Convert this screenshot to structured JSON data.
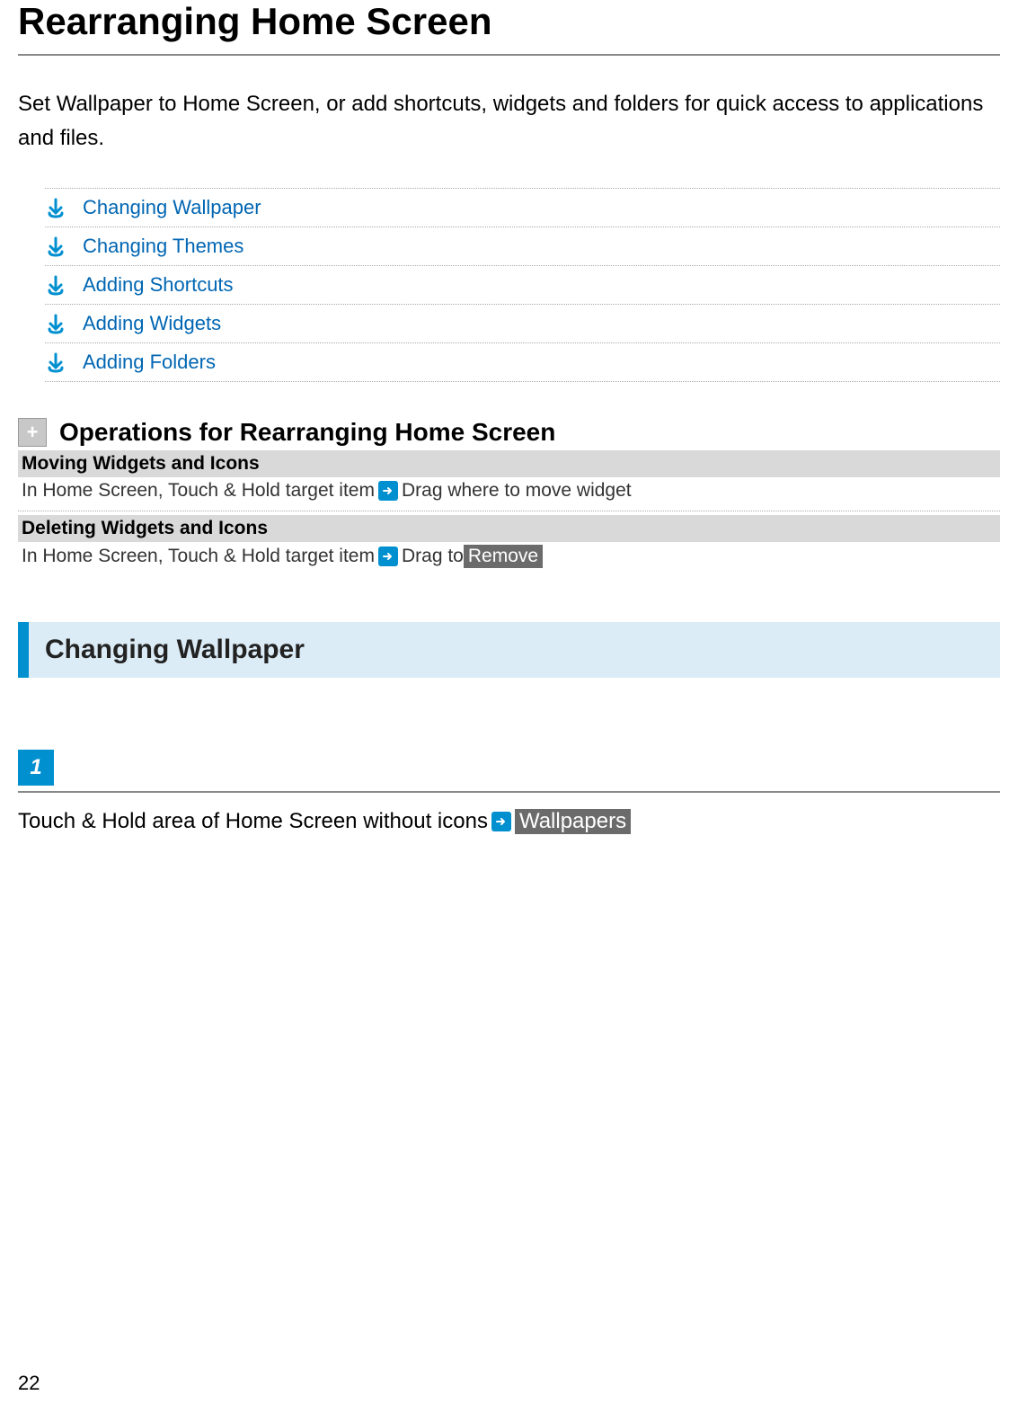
{
  "title": "Rearranging Home Screen",
  "intro": "Set Wallpaper to Home Screen, or add shortcuts, widgets and folders for quick access to applications and files.",
  "toc": [
    {
      "label": "Changing Wallpaper"
    },
    {
      "label": "Changing Themes"
    },
    {
      "label": "Adding Shortcuts"
    },
    {
      "label": "Adding Widgets"
    },
    {
      "label": "Adding Folders"
    }
  ],
  "operations_heading": "Operations for Rearranging Home Screen",
  "op1": {
    "title": "Moving Widgets and Icons",
    "part1": "In Home Screen, Touch & Hold target item",
    "part2": " Drag where to move widget"
  },
  "op2": {
    "title": "Deleting Widgets and Icons",
    "part1": "In Home Screen, Touch & Hold target item",
    "part2": " Drag to ",
    "badge": "Remove"
  },
  "section1": {
    "heading": "Changing Wallpaper",
    "step_number": "1",
    "step_text_part1": "Touch & Hold area of Home Screen without icons",
    "step_badge": "Wallpapers"
  },
  "page_number": "22"
}
